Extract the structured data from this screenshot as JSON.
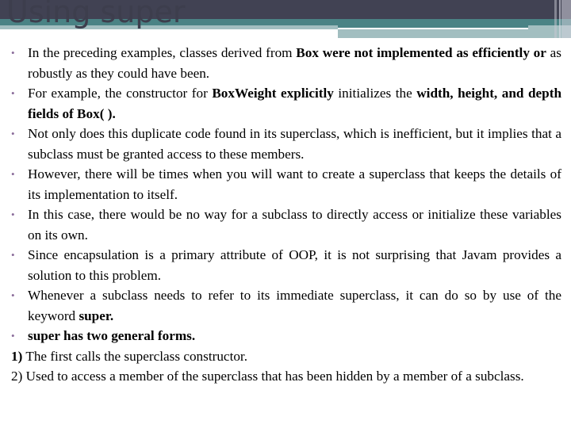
{
  "slide": {
    "title": "Using super",
    "colors": {
      "header_dark": "#414253",
      "header_teal": "#4a8385",
      "header_light": "#a2bec0",
      "title_text": "#3d3e4d",
      "bullet": "#8a6c9a",
      "body_text": "#000000"
    },
    "bullets": [
      {
        "parts": [
          {
            "t": "In the preceding examples, classes derived from ",
            "b": false
          },
          {
            "t": "Box were not implemented as efficiently or",
            "b": true
          },
          {
            "t": " as robustly as they could have been.",
            "b": false
          }
        ]
      },
      {
        "parts": [
          {
            "t": "For example, the constructor for ",
            "b": false
          },
          {
            "t": "BoxWeight explicitly",
            "b": true
          },
          {
            "t": " initializes the ",
            "b": false
          },
          {
            "t": "width, height, and depth fields of Box( ).",
            "b": true
          }
        ]
      },
      {
        "parts": [
          {
            "t": "Not only does this duplicate code found in its superclass, which is inefficient, but it implies that a subclass must be granted access to these members.",
            "b": false
          }
        ]
      },
      {
        "parts": [
          {
            "t": "However, there will be times when you will want to create a superclass that keeps the details of its implementation to itself.",
            "b": false
          }
        ]
      },
      {
        "parts": [
          {
            "t": "In this case, there would be no way for a subclass to directly access or initialize these variables on its own.",
            "b": false
          }
        ]
      },
      {
        "parts": [
          {
            "t": "Since encapsulation is a primary attribute of OOP, it is not surprising that Javam provides a solution to this problem.",
            "b": false
          }
        ]
      },
      {
        "parts": [
          {
            "t": "Whenever a subclass needs to refer to its immediate superclass, it can do so by use of the keyword ",
            "b": false
          },
          {
            "t": "super.",
            "b": true
          }
        ]
      },
      {
        "parts": [
          {
            "t": "super has two general forms.",
            "b": true
          }
        ]
      }
    ],
    "numbered": [
      {
        "num": "1)",
        "num_bold": true,
        "text": " The first calls the superclass constructor."
      },
      {
        "num": "2)",
        "num_bold": false,
        "text": " Used to access a member of the superclass that has been hidden by a member of a subclass."
      }
    ],
    "bullet_glyph": "•"
  }
}
